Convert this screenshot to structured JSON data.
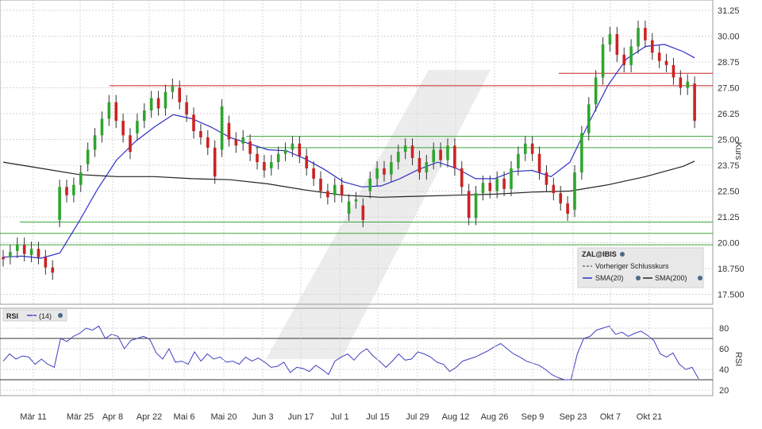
{
  "chart_data": [
    {
      "type": "candlestick",
      "ylabel": "Kurs",
      "ylim": [
        17.0,
        31.5
      ],
      "y_ticks": [
        "31.25",
        "30.00",
        "28.75",
        "27.50",
        "26.25",
        "25.00",
        "23.75",
        "22.50",
        "21.25",
        "20.00",
        "18.750",
        "17.500"
      ],
      "x_ticks": [
        "Mär 11",
        "Mär 25",
        "Apr 8",
        "Apr 22",
        "Mai 6",
        "Mai 20",
        "Jun 3",
        "Jun 17",
        "Jul 1",
        "Jul 15",
        "Jul 29",
        "Aug 12",
        "Aug 26",
        "Sep 9",
        "Sep 23",
        "Okt 7",
        "Okt 21"
      ],
      "series": [
        {
          "name": "SMA(20)",
          "color": "#2f2fc8",
          "x": [
            0,
            5,
            10,
            15,
            20,
            25,
            30,
            35,
            40,
            45,
            50,
            55,
            60,
            65,
            70,
            75,
            80,
            85,
            90,
            95,
            100,
            105,
            110,
            115,
            120,
            125,
            130,
            135,
            140,
            145,
            150,
            155,
            160,
            165,
            170,
            175,
            180,
            183
          ],
          "values": [
            19.3,
            19.35,
            19.25,
            19.5,
            21.0,
            22.6,
            24.0,
            24.9,
            25.6,
            26.2,
            26.0,
            25.6,
            25.1,
            24.8,
            24.5,
            24.45,
            24.05,
            23.55,
            22.95,
            22.7,
            22.75,
            23.1,
            23.55,
            23.9,
            23.6,
            23.1,
            23.1,
            23.45,
            23.5,
            23.2,
            23.9,
            25.8,
            27.6,
            28.9,
            29.5,
            29.6,
            29.25,
            28.95
          ]
        },
        {
          "name": "SMA(200)",
          "color": "#222222",
          "x": [
            0,
            10,
            20,
            30,
            40,
            50,
            60,
            70,
            80,
            90,
            100,
            110,
            120,
            130,
            140,
            150,
            160,
            170,
            180,
            183
          ],
          "values": [
            23.9,
            23.6,
            23.3,
            23.2,
            23.2,
            23.1,
            23.05,
            22.85,
            22.55,
            22.3,
            22.2,
            22.25,
            22.3,
            22.35,
            22.45,
            22.5,
            22.8,
            23.2,
            23.7,
            23.95
          ]
        }
      ],
      "candles": [
        {
          "x": 0,
          "o": 19.3,
          "c": 19.2
        },
        {
          "x": 2,
          "o": 19.3,
          "c": 19.55
        },
        {
          "x": 4,
          "o": 19.6,
          "c": 19.9
        },
        {
          "x": 6,
          "o": 19.9,
          "c": 19.45
        },
        {
          "x": 8,
          "o": 19.4,
          "c": 19.7
        },
        {
          "x": 10,
          "o": 19.7,
          "c": 19.3
        },
        {
          "x": 12,
          "o": 19.3,
          "c": 18.8
        },
        {
          "x": 14,
          "o": 18.8,
          "c": 18.55
        },
        {
          "x": 16,
          "o": 21.1,
          "c": 22.7
        },
        {
          "x": 18,
          "o": 22.7,
          "c": 22.3
        },
        {
          "x": 20,
          "o": 22.3,
          "c": 22.8
        },
        {
          "x": 22,
          "o": 22.8,
          "c": 23.4
        },
        {
          "x": 24,
          "o": 23.8,
          "c": 24.5
        },
        {
          "x": 26,
          "o": 24.5,
          "c": 25.2
        },
        {
          "x": 28,
          "o": 25.2,
          "c": 26.0
        },
        {
          "x": 30,
          "o": 26.0,
          "c": 26.8
        },
        {
          "x": 32,
          "o": 26.8,
          "c": 25.9
        },
        {
          "x": 34,
          "o": 25.9,
          "c": 25.2
        },
        {
          "x": 36,
          "o": 25.2,
          "c": 24.4
        },
        {
          "x": 38,
          "o": 25.3,
          "c": 25.9
        },
        {
          "x": 40,
          "o": 25.9,
          "c": 26.4
        },
        {
          "x": 42,
          "o": 26.4,
          "c": 27.0
        },
        {
          "x": 44,
          "o": 27.0,
          "c": 26.5
        },
        {
          "x": 46,
          "o": 26.5,
          "c": 27.3
        },
        {
          "x": 48,
          "o": 27.3,
          "c": 27.6
        },
        {
          "x": 50,
          "o": 27.5,
          "c": 26.8
        },
        {
          "x": 52,
          "o": 26.8,
          "c": 26.2
        },
        {
          "x": 54,
          "o": 26.2,
          "c": 25.4
        },
        {
          "x": 56,
          "o": 25.4,
          "c": 25.1
        },
        {
          "x": 58,
          "o": 25.1,
          "c": 24.6
        },
        {
          "x": 60,
          "o": 24.6,
          "c": 23.2
        },
        {
          "x": 62,
          "o": 24.5,
          "c": 26.6
        },
        {
          "x": 64,
          "o": 25.8,
          "c": 25.0
        },
        {
          "x": 66,
          "o": 25.0,
          "c": 24.7
        },
        {
          "x": 68,
          "o": 24.8,
          "c": 25.1
        },
        {
          "x": 70,
          "o": 24.9,
          "c": 24.3
        },
        {
          "x": 72,
          "o": 24.3,
          "c": 23.9
        },
        {
          "x": 74,
          "o": 23.9,
          "c": 23.5
        },
        {
          "x": 76,
          "o": 23.6,
          "c": 23.9
        },
        {
          "x": 78,
          "o": 23.9,
          "c": 24.3
        },
        {
          "x": 80,
          "o": 24.3,
          "c": 24.5
        },
        {
          "x": 82,
          "o": 24.5,
          "c": 24.8
        },
        {
          "x": 84,
          "o": 24.8,
          "c": 24.2
        },
        {
          "x": 86,
          "o": 24.2,
          "c": 23.6
        },
        {
          "x": 88,
          "o": 23.6,
          "c": 23.1
        },
        {
          "x": 90,
          "o": 23.1,
          "c": 22.5
        },
        {
          "x": 92,
          "o": 22.5,
          "c": 22.2
        },
        {
          "x": 94,
          "o": 22.3,
          "c": 22.8
        },
        {
          "x": 96,
          "o": 22.8,
          "c": 22.3
        },
        {
          "x": 98,
          "o": 21.4,
          "c": 22.0
        },
        {
          "x": 100,
          "o": 22.0,
          "c": 22.1
        },
        {
          "x": 102,
          "o": 21.8,
          "c": 21.1
        },
        {
          "x": 104,
          "o": 22.5,
          "c": 23.1
        },
        {
          "x": 106,
          "o": 23.1,
          "c": 23.6
        },
        {
          "x": 108,
          "o": 23.6,
          "c": 23.3
        },
        {
          "x": 110,
          "o": 23.3,
          "c": 23.9
        },
        {
          "x": 112,
          "o": 23.9,
          "c": 24.4
        },
        {
          "x": 114,
          "o": 24.4,
          "c": 24.7
        },
        {
          "x": 116,
          "o": 24.7,
          "c": 24.1
        },
        {
          "x": 118,
          "o": 24.1,
          "c": 23.4
        },
        {
          "x": 120,
          "o": 23.4,
          "c": 23.9
        },
        {
          "x": 122,
          "o": 23.9,
          "c": 24.5
        },
        {
          "x": 124,
          "o": 24.5,
          "c": 24.0
        },
        {
          "x": 126,
          "o": 24.0,
          "c": 24.7
        },
        {
          "x": 128,
          "o": 24.7,
          "c": 23.6
        },
        {
          "x": 130,
          "o": 23.6,
          "c": 22.7
        },
        {
          "x": 132,
          "o": 22.5,
          "c": 21.2
        },
        {
          "x": 134,
          "o": 21.2,
          "c": 22.4
        },
        {
          "x": 136,
          "o": 22.4,
          "c": 22.9
        },
        {
          "x": 138,
          "o": 22.9,
          "c": 22.5
        },
        {
          "x": 140,
          "o": 22.5,
          "c": 23.1
        },
        {
          "x": 142,
          "o": 23.1,
          "c": 22.6
        },
        {
          "x": 144,
          "o": 22.6,
          "c": 23.6
        },
        {
          "x": 146,
          "o": 23.6,
          "c": 24.3
        },
        {
          "x": 148,
          "o": 24.3,
          "c": 24.8
        },
        {
          "x": 150,
          "o": 24.8,
          "c": 24.3
        },
        {
          "x": 152,
          "o": 24.3,
          "c": 23.4
        },
        {
          "x": 154,
          "o": 23.4,
          "c": 22.8
        },
        {
          "x": 156,
          "o": 22.8,
          "c": 22.4
        },
        {
          "x": 158,
          "o": 22.4,
          "c": 21.9
        },
        {
          "x": 160,
          "o": 21.9,
          "c": 21.4
        },
        {
          "x": 162,
          "o": 21.6,
          "c": 23.4
        },
        {
          "x": 164,
          "o": 23.4,
          "c": 25.3
        },
        {
          "x": 166,
          "o": 25.3,
          "c": 26.7
        },
        {
          "x": 168,
          "o": 26.7,
          "c": 28.0
        },
        {
          "x": 170,
          "o": 28.0,
          "c": 29.6
        },
        {
          "x": 172,
          "o": 29.6,
          "c": 30.1
        },
        {
          "x": 174,
          "o": 30.1,
          "c": 29.1
        },
        {
          "x": 176,
          "o": 29.1,
          "c": 28.6
        },
        {
          "x": 178,
          "o": 28.6,
          "c": 29.5
        },
        {
          "x": 180,
          "o": 29.5,
          "c": 30.4
        },
        {
          "x": 182,
          "o": 30.4,
          "c": 29.8
        },
        {
          "x": 184,
          "o": 29.8,
          "c": 29.2
        },
        {
          "x": 186,
          "o": 29.2,
          "c": 28.8
        },
        {
          "x": 188,
          "o": 28.8,
          "c": 28.6
        },
        {
          "x": 190,
          "o": 28.6,
          "c": 28.0
        },
        {
          "x": 192,
          "o": 28.0,
          "c": 27.5
        },
        {
          "x": 194,
          "o": 27.5,
          "c": 27.8
        },
        {
          "x": 196,
          "o": 27.7,
          "c": 25.9
        }
      ],
      "hlines": [
        {
          "y": 27.6,
          "color": "#cc2222"
        },
        {
          "y": 28.2,
          "color": "#cc2222"
        },
        {
          "y": 25.15,
          "color": "#3aa63a"
        },
        {
          "y": 24.6,
          "color": "#3aa63a"
        },
        {
          "y": 21.0,
          "color": "#3aa63a"
        },
        {
          "y": 20.45,
          "color": "#3aa63a"
        },
        {
          "y": 19.9,
          "color": "#3aa63a"
        }
      ],
      "legend": {
        "title": "ZAL@IBIS",
        "items": [
          "Vorheriger Schlusskurs",
          "SMA(20)",
          "SMA(200)"
        ]
      }
    },
    {
      "type": "line",
      "ylabel": "RSI",
      "title": "RSI",
      "legend_item": "(14)",
      "ylim": [
        14,
        92
      ],
      "y_ticks": [
        "80",
        "60",
        "40",
        "20"
      ],
      "levels": [
        70,
        30
      ],
      "series": [
        {
          "name": "(14)",
          "color": "#4040c0",
          "values": [
            48,
            55,
            50,
            53,
            52,
            45,
            50,
            45,
            42,
            70,
            67,
            72,
            75,
            80,
            78,
            82,
            70,
            74,
            72,
            60,
            68,
            70,
            72,
            69,
            56,
            50,
            60,
            47,
            48,
            45,
            57,
            48,
            55,
            50,
            52,
            47,
            48,
            45,
            52,
            48,
            51,
            47,
            42,
            43,
            47,
            37,
            42,
            41,
            38,
            44,
            40,
            35,
            48,
            52,
            55,
            49,
            56,
            60,
            53,
            48,
            42,
            48,
            55,
            49,
            50,
            57,
            55,
            52,
            47,
            45,
            38,
            42,
            48,
            50,
            52,
            55,
            58,
            62,
            65,
            60,
            55,
            52,
            48,
            46,
            44,
            40,
            35,
            32,
            30,
            30,
            55,
            70,
            72,
            78,
            80,
            82,
            74,
            76,
            72,
            75,
            77,
            73,
            68,
            55,
            52,
            56,
            45,
            40,
            42,
            31
          ]
        }
      ]
    }
  ]
}
